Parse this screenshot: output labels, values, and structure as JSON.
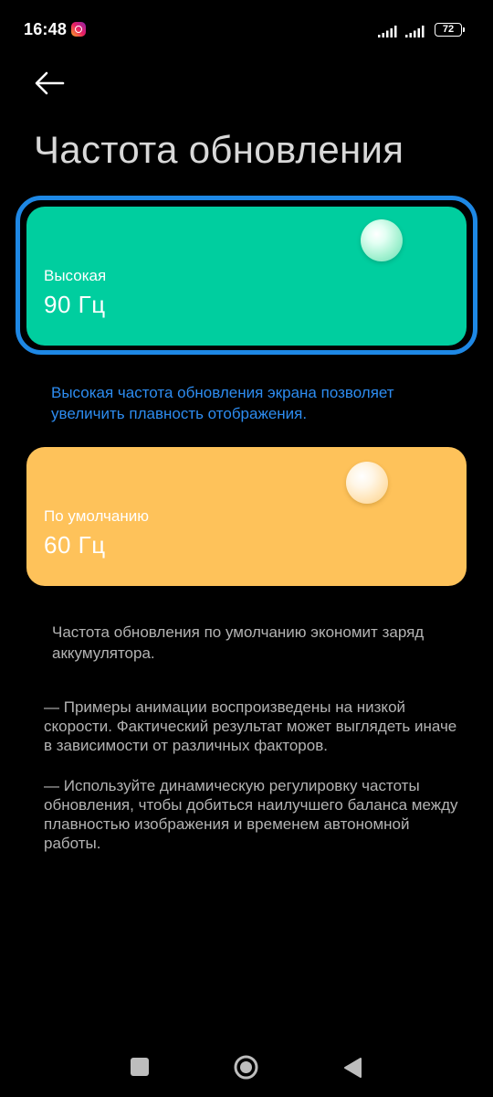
{
  "status_bar": {
    "time": "16:48",
    "notification_icon": "instagram-icon",
    "battery_level": "72"
  },
  "header": {
    "back_icon": "arrow-left-icon",
    "title": "Частота обновления"
  },
  "options": {
    "high": {
      "label": "Высокая",
      "value": "90 Гц",
      "selected": true,
      "color": "#00ce9f",
      "description": "Высокая частота обновления экрана позволяет увеличить плавность отображения."
    },
    "default": {
      "label": "По умолчанию",
      "value": "60 Гц",
      "selected": false,
      "color": "#fec25a",
      "description": "Частота обновления по умолчанию экономит заряд аккумулятора."
    }
  },
  "notes": {
    "note_1": "— Примеры анимации воспроизведены на низкой скорости. Фактический результат может выглядеть иначе в зависимости от различных факторов.",
    "note_2": "— Используйте динамическую регулировку частоты обновления, чтобы добиться наилучшего баланса между плавностью изображения и временем автономной работы."
  },
  "colors": {
    "background": "#000000",
    "accent": "#1e88e5",
    "link_text": "#2d8cf0"
  },
  "nav_bar": {
    "recents_icon": "square-icon",
    "home_icon": "circle-home-icon",
    "back_icon": "triangle-back-icon"
  }
}
